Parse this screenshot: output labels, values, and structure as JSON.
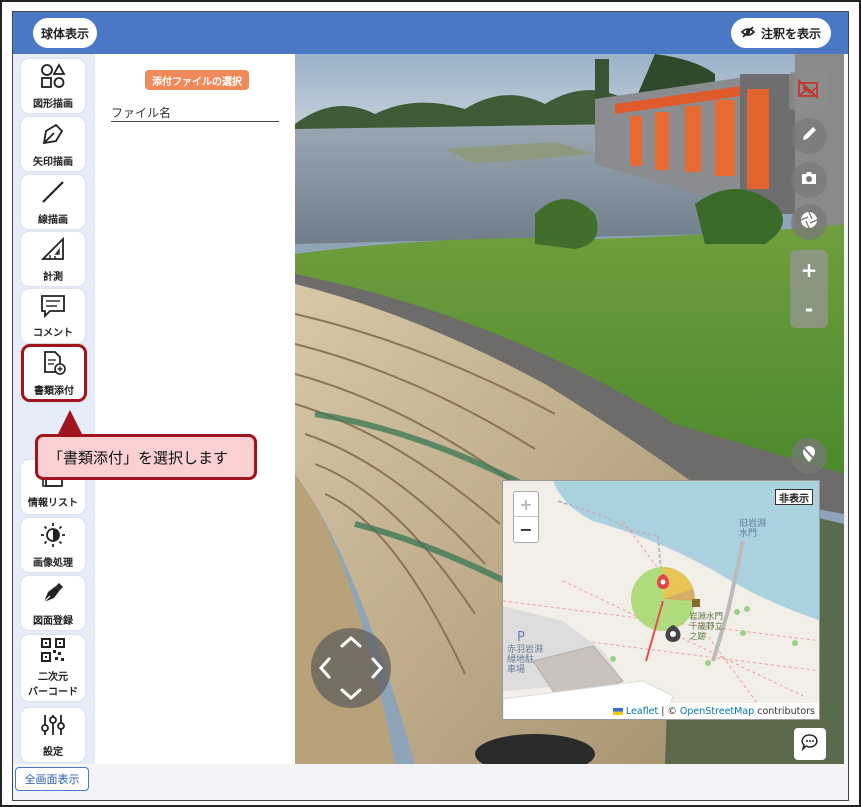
{
  "header": {
    "sphere_button": "球体表示",
    "annotation_button": "注釈を表示"
  },
  "toolbar": {
    "items": [
      {
        "label": "図形描画",
        "icon": "shapes-icon"
      },
      {
        "label": "矢印描画",
        "icon": "arrow-draw-icon"
      },
      {
        "label": "線描画",
        "icon": "line-draw-icon"
      },
      {
        "label": "計測",
        "icon": "ruler-icon"
      },
      {
        "label": "コメント",
        "icon": "comment-icon"
      },
      {
        "label": "書類添付",
        "icon": "document-attach-icon",
        "selected": true
      },
      {
        "label": "情報リスト",
        "icon": "info-list-icon"
      },
      {
        "label": "画像処理",
        "icon": "brightness-icon"
      },
      {
        "label": "図面登録",
        "icon": "pen-nib-icon"
      },
      {
        "label_line1": "二次元",
        "label_line2": "バーコード",
        "icon": "qr-code-icon"
      },
      {
        "label": "設定",
        "icon": "settings-sliders-icon"
      }
    ]
  },
  "panel": {
    "attach_button": "添付ファイルの選択",
    "file_name_label": "ファイル名"
  },
  "bottom": {
    "fullscreen_button": "全画面表示"
  },
  "annotation": {
    "text": "「書類添付」を選択します",
    "color": "#a0141d",
    "fill": "#fbd0d2"
  },
  "viewer": {
    "zoom_in": "+",
    "zoom_out": "-"
  },
  "minimap": {
    "zoom_in": "+",
    "zoom_out": "−",
    "hide_button": "非表示",
    "attribution_leaflet": "Leaflet",
    "attribution_sep": "| ©",
    "attribution_osm": "OpenStreetMap",
    "attribution_contrib": "contributors",
    "labels": {
      "parking": "赤羽岩淵\n緑地駐\n車場",
      "parking_letter": "P",
      "canal": "旧岩淵\n水門",
      "poi": "岩淵水門\n千歳野立\n之跡"
    }
  },
  "colors": {
    "header": "#4a78c5",
    "accent_orange": "#f08a5a"
  }
}
